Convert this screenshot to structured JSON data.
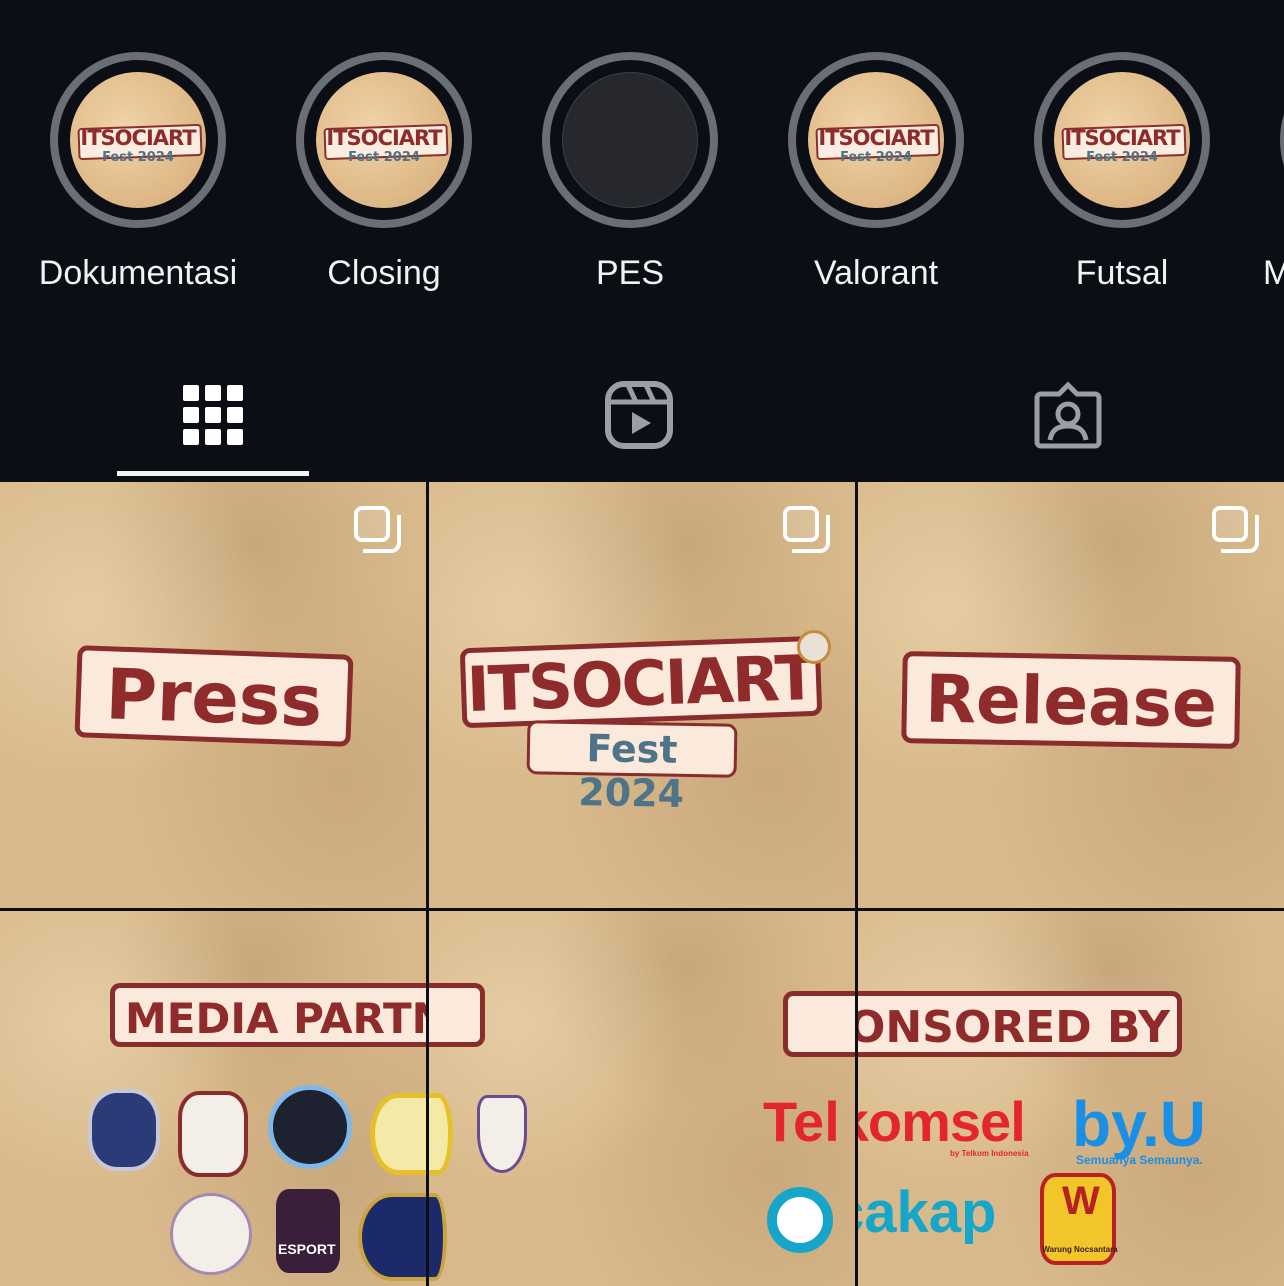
{
  "highlights": [
    {
      "label": "Dokumentasi",
      "logo_title": "ITSOCIART",
      "logo_sub": "Fest 2024",
      "has_cover": true
    },
    {
      "label": "Closing",
      "logo_title": "ITSOCIART",
      "logo_sub": "Fest 2024",
      "has_cover": true
    },
    {
      "label": "PES",
      "has_cover": false
    },
    {
      "label": "Valorant",
      "logo_title": "ITSOCIART",
      "logo_sub": "Fest 2024",
      "has_cover": true
    },
    {
      "label": "Futsal",
      "logo_title": "ITSOCIART",
      "logo_sub": "Fest 2024",
      "has_cover": true
    },
    {
      "label": "M",
      "has_cover": false
    }
  ],
  "tabs": [
    {
      "name": "posts",
      "icon": "grid-icon",
      "active": true
    },
    {
      "name": "reels",
      "icon": "reels-icon",
      "active": false
    },
    {
      "name": "tagged",
      "icon": "tagged-person-icon",
      "active": false
    }
  ],
  "posts": {
    "press": {
      "text": "Press"
    },
    "itsociart": {
      "title": "ITSOCIART",
      "sub": "Fest 2024"
    },
    "release": {
      "text": "Release"
    },
    "media_partner": {
      "heading": "MEDIA PARTNER",
      "badge_text": "ESPORT"
    },
    "sponsored": {
      "heading": "SPONSORED BY",
      "telkomsel": "Telkomsel",
      "telkomsel_sub": "by Telkom Indonesia",
      "byu": "by.U",
      "byu_sub": "Semuanya Semaunya.",
      "cakap": "cakap",
      "warung": "Warung Nocsantara"
    }
  },
  "colors": {
    "background": "#0b0e15",
    "paper": "#d8b98b",
    "accent_red": "#8e2b2b",
    "accent_blue": "#4d7488"
  }
}
